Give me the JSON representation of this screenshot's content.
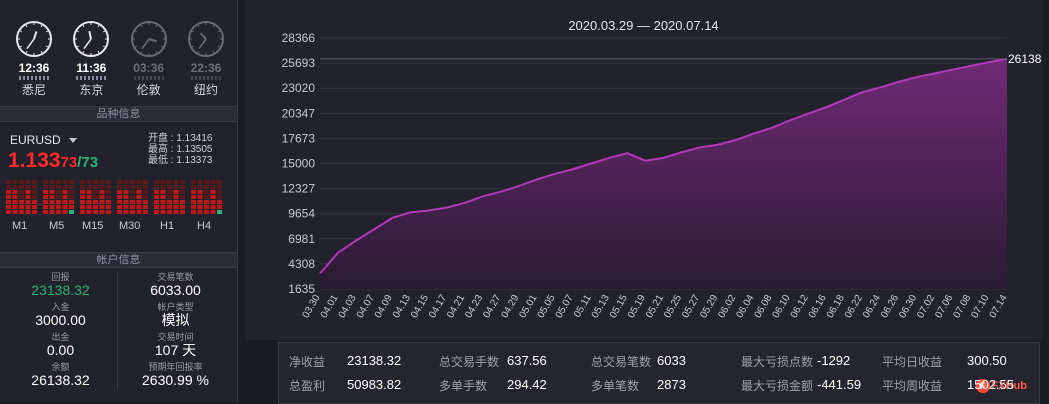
{
  "clocks": [
    {
      "time": "12:36",
      "city": "悉尼",
      "active": true,
      "h": 12.6,
      "m": 36
    },
    {
      "time": "11:36",
      "city": "东京",
      "active": true,
      "h": 11.6,
      "m": 36
    },
    {
      "time": "03:36",
      "city": "伦敦",
      "active": false,
      "h": 3.6,
      "m": 36
    },
    {
      "time": "22:36",
      "city": "纽约",
      "active": false,
      "h": 22.6,
      "m": 36
    }
  ],
  "symbol_section": {
    "title": "品种信息"
  },
  "symbol": {
    "name": "EURUSD",
    "price_main": "1.133",
    "price_small": "73",
    "price_sep": "/",
    "price_green": "73"
  },
  "ohl": {
    "open_label": "开盘",
    "open": "1.13416",
    "high_label": "最高",
    "high": "1.13505",
    "low_label": "最低",
    "low": "1.13373"
  },
  "timeframes": [
    "M1",
    "M5",
    "M15",
    "M30",
    "H1",
    "H4"
  ],
  "account_section": {
    "title": "帐户信息"
  },
  "account": [
    {
      "label": "回报",
      "value": "23138.32",
      "green": true
    },
    {
      "label": "交易笔数",
      "value": "6033.00"
    },
    {
      "label": "入金",
      "value": "3000.00"
    },
    {
      "label": "帐户类型",
      "value": "模拟"
    },
    {
      "label": "出金",
      "value": "0.00"
    },
    {
      "label": "交易时间",
      "value": "107 天"
    },
    {
      "label": "余额",
      "value": "26138.32"
    },
    {
      "label": "预期年回报率",
      "value": "2630.99 %"
    }
  ],
  "chart_data": {
    "type": "area",
    "title": "2020.03.29 — 2020.07.14",
    "y_ticks": [
      "28366",
      "25693",
      "23020",
      "20347",
      "17673",
      "15000",
      "12327",
      "9654",
      "6981",
      "4308",
      "1635"
    ],
    "ylim": [
      1635,
      28366
    ],
    "x_ticks": [
      "03.30",
      "04.01",
      "04.03",
      "04.07",
      "04.09",
      "04.13",
      "04.15",
      "04.17",
      "04.21",
      "04.23",
      "04.27",
      "04.29",
      "05.01",
      "05.05",
      "05.07",
      "05.11",
      "05.13",
      "05.15",
      "05.19",
      "05.21",
      "05.25",
      "05.27",
      "05.29",
      "06.02",
      "06.04",
      "06.08",
      "06.10",
      "06.12",
      "06.16",
      "06.18",
      "06.22",
      "06.24",
      "06.26",
      "06.30",
      "07.02",
      "07.06",
      "07.08",
      "07.10",
      "07.14"
    ],
    "values": [
      3300,
      5500,
      6800,
      8000,
      9200,
      9800,
      10000,
      10300,
      10800,
      11500,
      12000,
      12600,
      13300,
      13900,
      14400,
      15000,
      15600,
      16100,
      15300,
      15600,
      16200,
      16700,
      17000,
      17500,
      18200,
      18800,
      19600,
      20300,
      21000,
      21800,
      22600,
      23100,
      23700,
      24200,
      24600,
      25000,
      25400,
      25800,
      26138
    ],
    "last_label": "26138.",
    "color": "#b03ab5"
  },
  "stats": [
    {
      "label": "净收益",
      "value": "23138.32"
    },
    {
      "label": "总交易手数",
      "value": "637.56"
    },
    {
      "label": "总交易笔数",
      "value": "6033"
    },
    {
      "label": "最大亏损点数",
      "value": "-1292"
    },
    {
      "label": "平均日收益",
      "value": "300.50"
    },
    {
      "label": "总盈利",
      "value": "50983.82"
    },
    {
      "label": "多单手数",
      "value": "294.42"
    },
    {
      "label": "多单笔数",
      "value": "2873"
    },
    {
      "label": "最大亏损金额",
      "value": "-441.59"
    },
    {
      "label": "平均周收益",
      "value": "1502.55"
    }
  ],
  "watermark": "FXHub"
}
